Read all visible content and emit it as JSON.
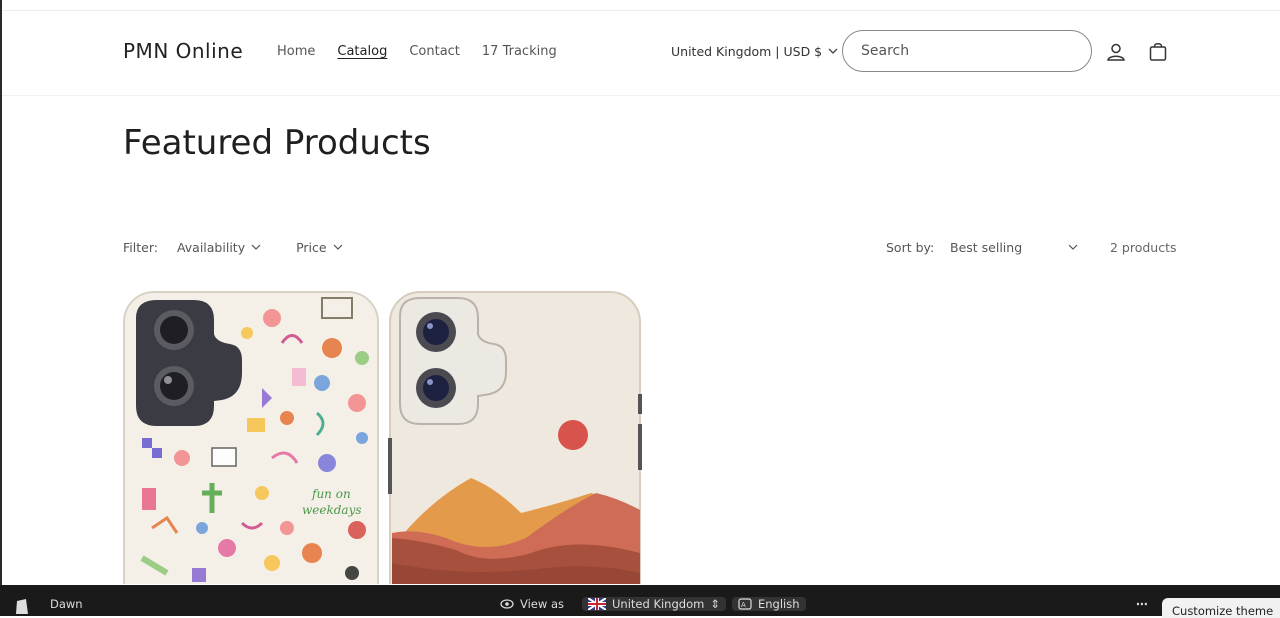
{
  "header": {
    "brand": "PMN Online",
    "nav": [
      "Home",
      "Catalog",
      "Contact",
      "17 Tracking"
    ],
    "active_nav": "Catalog",
    "locale": "United Kingdom | USD $",
    "search_placeholder": "Search"
  },
  "main": {
    "title": "Featured Products",
    "filter_label": "Filter:",
    "filters": [
      "Availability",
      "Price"
    ],
    "sort_label": "Sort by:",
    "sort_value": "Best selling",
    "product_count": "2 products"
  },
  "products": [
    {
      "name": "doodle-phone-case",
      "colors": {
        "case": "#f4f0e8",
        "frame": "#3b3b44"
      }
    },
    {
      "name": "mountain-sunset-phone-case",
      "colors": {
        "case": "#efe8de",
        "sun": "#d8534c",
        "hill1": "#e39a4a",
        "hill2": "#cf6c55",
        "hill3": "#a8503e"
      }
    }
  ],
  "bottom_bar": {
    "theme": "Dawn",
    "view_as": "View as",
    "country": "United Kingdom",
    "language": "English",
    "customize": "Customize theme"
  }
}
